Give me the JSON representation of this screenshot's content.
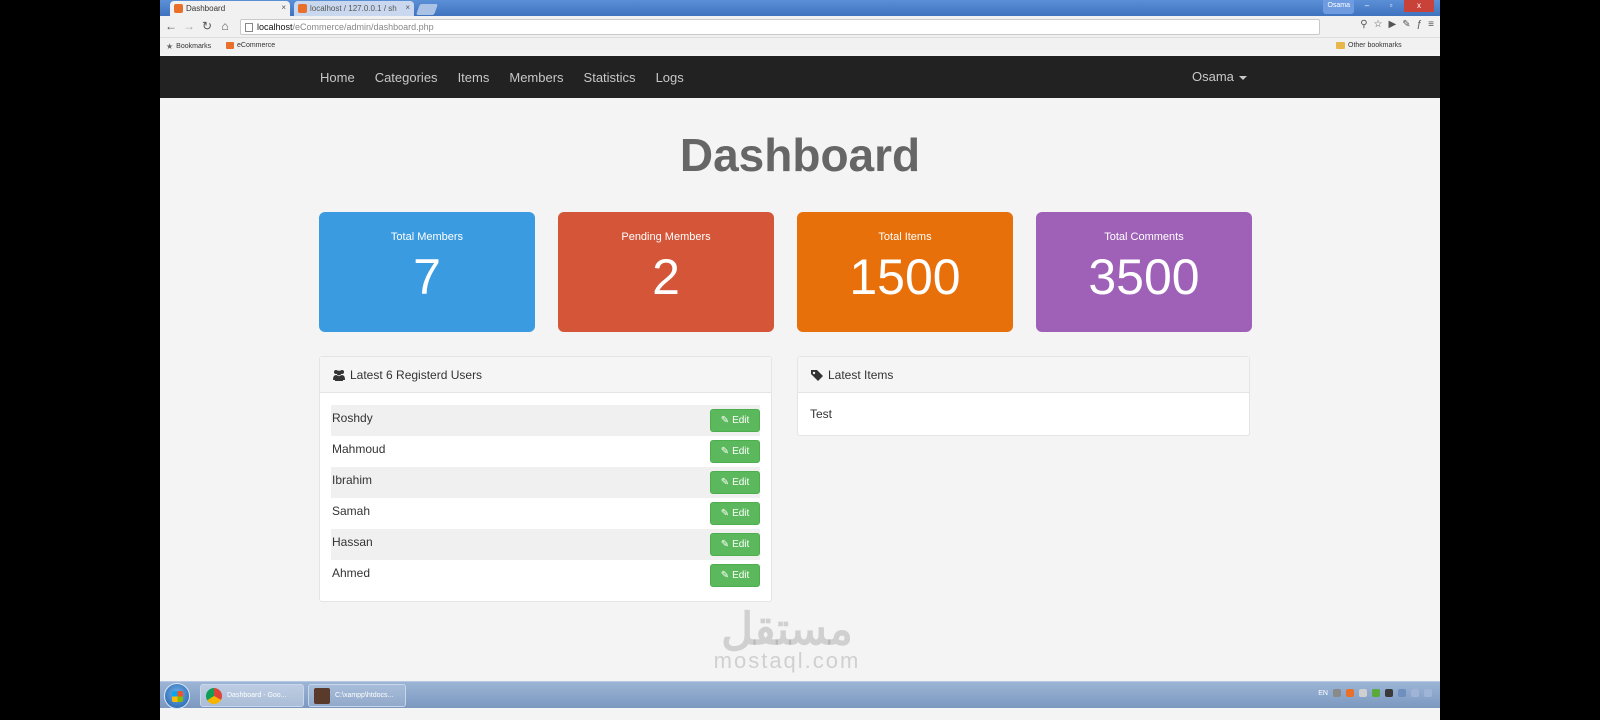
{
  "browser": {
    "tabs": [
      {
        "label": "Dashboard",
        "active": true
      },
      {
        "label": "localhost / 127.0.0.1 / sh",
        "active": false
      }
    ],
    "window_user": "Osama",
    "url_host": "localhost",
    "url_path": "/eCommerce/admin/dashboard.php",
    "bookmarks": [
      "Bookmarks",
      "eCommerce"
    ],
    "other_bookmarks": "Other bookmarks"
  },
  "navbar": {
    "links": [
      "Home",
      "Categories",
      "Items",
      "Members",
      "Statistics",
      "Logs"
    ],
    "user": "Osama"
  },
  "page": {
    "title": "Dashboard"
  },
  "stats": [
    {
      "label": "Total Members",
      "value": "7",
      "color": "#3498db"
    },
    {
      "label": "Pending Members",
      "value": "2",
      "color": "#d2533a"
    },
    {
      "label": "Total Items",
      "value": "1500",
      "color": "#e67e22"
    },
    {
      "label": "Total Comments",
      "value": "3500",
      "color": "#9b59b6"
    }
  ],
  "latest_users": {
    "heading": "Latest 6 Registerd Users",
    "edit_label": "Edit",
    "users": [
      "Roshdy",
      "Mahmoud",
      "Ibrahim",
      "Samah",
      "Hassan",
      "Ahmed"
    ]
  },
  "latest_items": {
    "heading": "Latest Items",
    "items": [
      "Test"
    ]
  },
  "watermark": {
    "arabic": "مستقل",
    "latin": "mostaql.com"
  },
  "taskbar": {
    "tasks": [
      "Dashboard - Goo...",
      "C:\\xampp\\htdocs..."
    ],
    "lang": "EN"
  }
}
